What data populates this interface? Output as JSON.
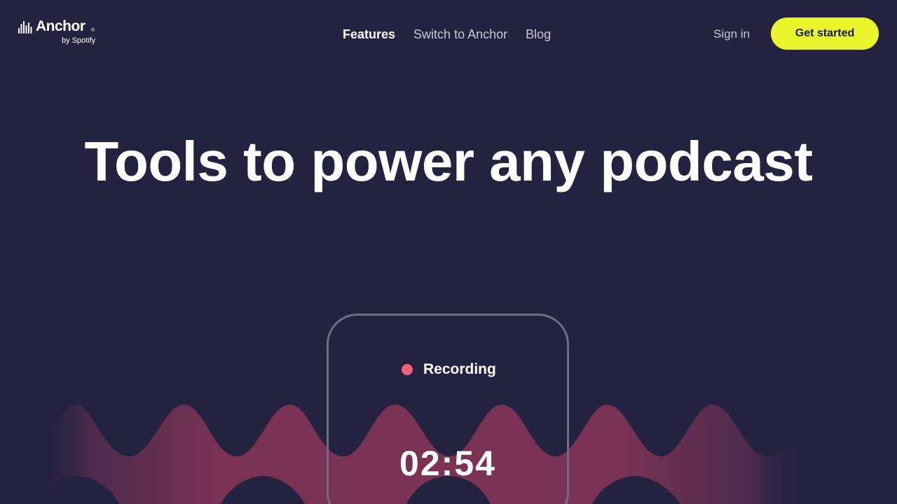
{
  "brand": {
    "name": "Anchor",
    "registered": "®",
    "tagline": "by Spotify"
  },
  "nav": {
    "items": [
      {
        "label": "Features",
        "active": true
      },
      {
        "label": "Switch to Anchor",
        "active": false
      },
      {
        "label": "Blog",
        "active": false
      }
    ]
  },
  "header": {
    "signin_label": "Sign in",
    "cta_label": "Get started"
  },
  "hero": {
    "title": "Tools to power any podcast"
  },
  "recorder": {
    "status": "Recording",
    "timer": "02:54"
  },
  "colors": {
    "background": "#252240",
    "cta": "#e8f52a",
    "recording_dot": "#f0617f",
    "wave": "#7a3354"
  },
  "icons": {
    "logo_mark": "anchor-waveform-icon",
    "recording": "record-dot-icon"
  }
}
